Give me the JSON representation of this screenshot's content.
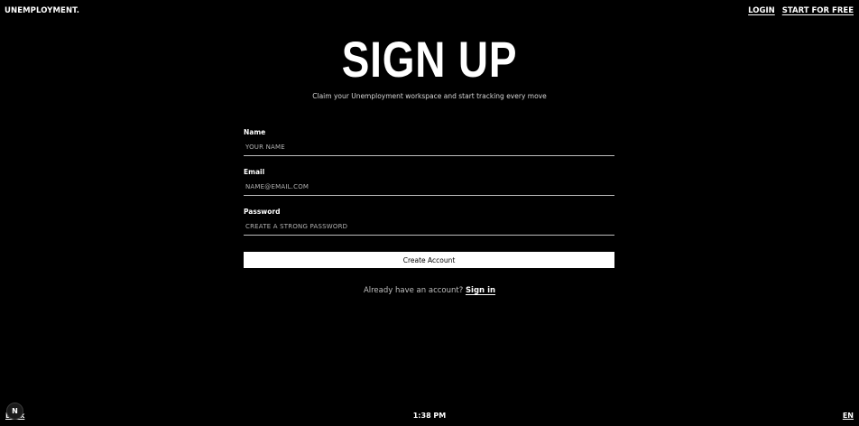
{
  "header": {
    "brand": "UNEMPLOYMENT.",
    "nav": {
      "login": "LOGIN",
      "start_free": "START FOR FREE"
    }
  },
  "hero": {
    "title": "SIGN UP",
    "subtitle": "Claim your Unemployment workspace and start tracking every move"
  },
  "form": {
    "name": {
      "label": "Name",
      "placeholder": "YOUR NAME",
      "value": ""
    },
    "email": {
      "label": "Email",
      "placeholder": "NAME@EMAIL.COM",
      "value": ""
    },
    "password": {
      "label": "Password",
      "placeholder": "CREATE A STRONG PASSWORD",
      "value": ""
    },
    "submit_label": "Create Account"
  },
  "signin": {
    "prompt": "Already have an account?",
    "link": "Sign in"
  },
  "footer": {
    "left_text": "Dark",
    "badge": "N",
    "time": "1:38 PM",
    "language": "EN"
  },
  "colors": {
    "background": "#000000",
    "text": "#ffffff",
    "button_bg": "#ffffff",
    "button_text": "#000000"
  }
}
